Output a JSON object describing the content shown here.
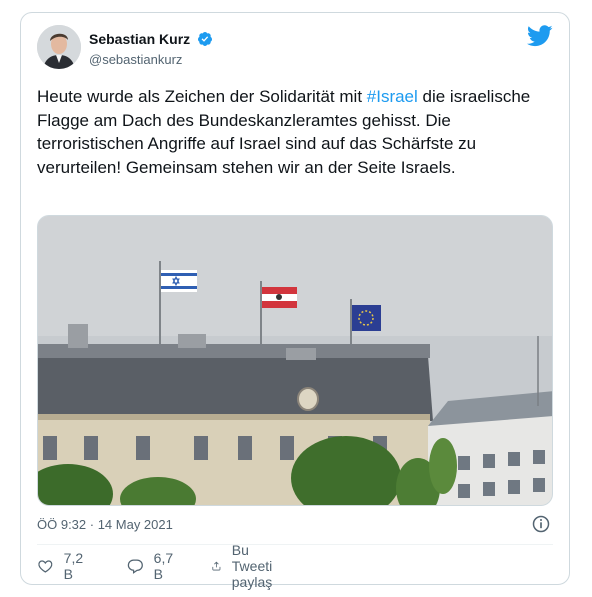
{
  "author": {
    "name": "Sebastian Kurz",
    "handle": "@sebastiankurz"
  },
  "tweet": {
    "text_before": "Heute wurde als Zeichen der Solidarität mit ",
    "hashtag": "#Israel",
    "text_after": " die israelische Flagge am Dach des Bundeskanzleramtes gehisst. Die terroristischen Angriffe auf Israel sind auf das Schärfste zu verurteilen! Gemeinsam stehen wir an der Seite Israels."
  },
  "timestamp": "ÖÖ 9:32 · 14 May 2021",
  "actions": {
    "likes": "7,2 B",
    "replies": "6,7 B",
    "share_label": "Bu Tweeti paylaş"
  },
  "colors": {
    "accent": "#1d9bf0",
    "text": "#0f1419",
    "muted": "#536471",
    "border": "#cfd9de"
  },
  "icons": [
    "verified-badge-icon",
    "twitter-bird-icon",
    "info-icon",
    "heart-icon",
    "reply-icon",
    "share-icon"
  ]
}
